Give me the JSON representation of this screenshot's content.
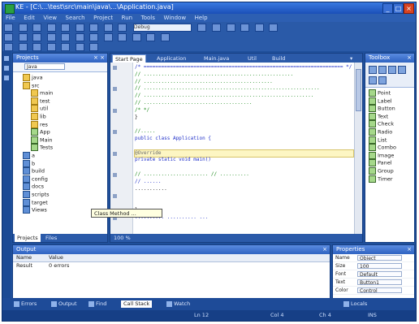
{
  "window": {
    "title": "KE - [C:\\...\\test\\src\\main\\java\\...\\Application.java]"
  },
  "menubar": {
    "items": [
      "File",
      "Edit",
      "View",
      "Search",
      "Project",
      "Run",
      "Tools",
      "Window",
      "Help"
    ]
  },
  "toolbar": {
    "config_select": "Debug"
  },
  "projects_panel": {
    "title": "Projects",
    "filter_value": "Java",
    "items": [
      {
        "label": "java",
        "indent": 2,
        "icon": "folder"
      },
      {
        "label": "src",
        "indent": 2,
        "icon": "folder"
      },
      {
        "label": "main",
        "indent": 4,
        "icon": "folder"
      },
      {
        "label": "test",
        "indent": 4,
        "icon": "folder"
      },
      {
        "label": "util",
        "indent": 4,
        "icon": "folder"
      },
      {
        "label": "lib",
        "indent": 4,
        "icon": "folder"
      },
      {
        "label": "res",
        "indent": 4,
        "icon": "folder"
      },
      {
        "label": "App",
        "indent": 4,
        "icon": "file"
      },
      {
        "label": "Main",
        "indent": 4,
        "icon": "file"
      },
      {
        "label": "Tests",
        "indent": 4,
        "icon": "file"
      },
      {
        "label": "a",
        "indent": 2,
        "icon": "blue"
      },
      {
        "label": "b",
        "indent": 2,
        "icon": "blue"
      },
      {
        "label": "build",
        "indent": 2,
        "icon": "blue"
      },
      {
        "label": "config",
        "indent": 2,
        "icon": "blue"
      },
      {
        "label": "docs",
        "indent": 2,
        "icon": "blue"
      },
      {
        "label": "scripts",
        "indent": 2,
        "icon": "blue"
      },
      {
        "label": "target",
        "indent": 2,
        "icon": "blue"
      },
      {
        "label": "Views",
        "indent": 2,
        "icon": "blue"
      }
    ],
    "footer_tabs": [
      "Projects",
      "Files"
    ]
  },
  "editor": {
    "tabs": [
      "Start Page",
      "Application",
      "Main.java",
      "Util",
      "Build"
    ],
    "active_tab": "Start Page",
    "lines": [
      {
        "text": "/* ==================================================================== */",
        "color": "blue"
      },
      {
        "text": "   // ...................................................",
        "color": "green"
      },
      {
        "text": "   // ............................................",
        "color": "green"
      },
      {
        "text": "   // ............................................................",
        "color": "green"
      },
      {
        "text": "   // ..........................................................",
        "color": "green"
      },
      {
        "text": "   // .....................................",
        "color": "green"
      },
      {
        "text": "   /* */",
        "color": "green"
      },
      {
        "text": "}",
        "color": "black"
      },
      {
        "text": "",
        "color": "black"
      },
      {
        "text": "//.....",
        "color": "green"
      },
      {
        "text": "public class Application {",
        "color": "blue"
      },
      {
        "text": "",
        "color": "black"
      },
      {
        "text": "  @Override",
        "color": "gray"
      },
      {
        "text": "  private static void main()",
        "color": "blue"
      },
      {
        "text": "",
        "color": "black"
      },
      {
        "text": "  // ......................      // ..........",
        "color": "green"
      },
      {
        "text": "  // ......",
        "color": "blue"
      },
      {
        "text": "  ...........",
        "color": "black"
      },
      {
        "text": "",
        "color": "black"
      },
      {
        "text": "",
        "color": "black"
      },
      {
        "text": "  }",
        "color": "black"
      },
      {
        "text": "  .......... ..........   ...",
        "color": "blue"
      }
    ],
    "highlighted_line": 12,
    "footer": "100 %"
  },
  "tooltip": {
    "text": "Class Method ..."
  },
  "right_panel": {
    "title": "Toolbox",
    "items": [
      "Point",
      "Label",
      "Button",
      "Text",
      "Check",
      "Radio",
      "List",
      "Combo",
      "Image",
      "Panel",
      "Group",
      "Timer"
    ]
  },
  "output_panel": {
    "title": "Output",
    "columns": [
      "Name",
      "Value"
    ],
    "rows": [
      [
        "Result",
        "0 errors"
      ]
    ]
  },
  "properties_panel": {
    "title": "Properties",
    "rows": [
      {
        "key": "Name",
        "value": "Object"
      },
      {
        "key": "Size",
        "value": "100"
      },
      {
        "key": "Font",
        "value": "Default"
      },
      {
        "key": "Text",
        "value": "Button1"
      },
      {
        "key": "Color",
        "value": "Control"
      }
    ]
  },
  "taskbar": {
    "items": [
      "Errors",
      "Output",
      "Find",
      "Call Stack",
      "Watch",
      "Locals"
    ],
    "selected": "Call Stack"
  },
  "statusbar": {
    "position": "Ln 12",
    "column": "Col 4",
    "char": "Ch 4",
    "mode": "INS"
  }
}
